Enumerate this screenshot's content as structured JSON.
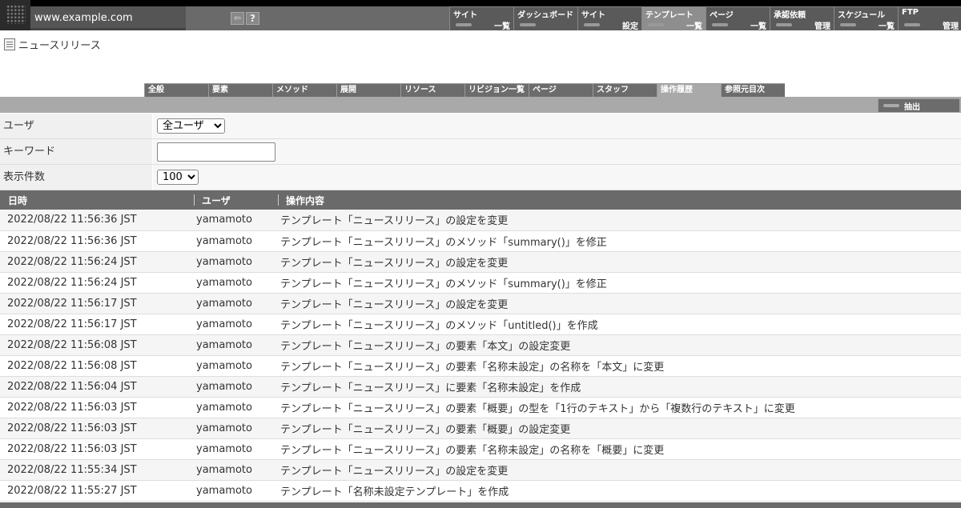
{
  "header": {
    "url": "www.example.com",
    "back_icon": "back-arrow-icon",
    "help_label": "?",
    "nav": [
      {
        "top": "サイト",
        "bottom": "一覧",
        "active": false
      },
      {
        "top": "ダッシュボード",
        "bottom": "",
        "active": false
      },
      {
        "top": "サイト",
        "bottom": "設定",
        "active": false
      },
      {
        "top": "テンプレート",
        "bottom": "一覧",
        "active": true
      },
      {
        "top": "ページ",
        "bottom": "一覧",
        "active": false
      },
      {
        "top": "承認依頼",
        "bottom": "管理",
        "active": false
      },
      {
        "top": "スケジュール",
        "bottom": "一覧",
        "active": false
      },
      {
        "top": "FTP",
        "bottom": "管理",
        "active": false
      }
    ]
  },
  "page": {
    "title": "ニュースリリース"
  },
  "tabs": [
    {
      "label": "全般",
      "active": false
    },
    {
      "label": "要素",
      "active": false
    },
    {
      "label": "メソッド",
      "active": false
    },
    {
      "label": "展開",
      "active": false
    },
    {
      "label": "リソース",
      "active": false
    },
    {
      "label": "リビジョン一覧",
      "active": false
    },
    {
      "label": "ページ",
      "active": false
    },
    {
      "label": "スタッフ",
      "active": false
    },
    {
      "label": "操作履歴",
      "active": true
    },
    {
      "label": "参照元目次",
      "active": false
    }
  ],
  "toolbar": {
    "extract_label": "抽出"
  },
  "filters": {
    "user_label": "ユーザ",
    "user_value": "全ユーザ",
    "keyword_label": "キーワード",
    "keyword_value": "",
    "count_label": "表示件数",
    "count_value": "100"
  },
  "table": {
    "headers": [
      "日時",
      "ユーザ",
      "操作内容"
    ],
    "rows": [
      [
        "2022/08/22 11:56:36 JST",
        "yamamoto",
        "テンプレート「ニュースリリース」の設定を変更"
      ],
      [
        "2022/08/22 11:56:36 JST",
        "yamamoto",
        "テンプレート「ニュースリリース」のメソッド「summary()」を修正"
      ],
      [
        "2022/08/22 11:56:24 JST",
        "yamamoto",
        "テンプレート「ニュースリリース」の設定を変更"
      ],
      [
        "2022/08/22 11:56:24 JST",
        "yamamoto",
        "テンプレート「ニュースリリース」のメソッド「summary()」を修正"
      ],
      [
        "2022/08/22 11:56:17 JST",
        "yamamoto",
        "テンプレート「ニュースリリース」の設定を変更"
      ],
      [
        "2022/08/22 11:56:17 JST",
        "yamamoto",
        "テンプレート「ニュースリリース」のメソッド「untitled()」を作成"
      ],
      [
        "2022/08/22 11:56:08 JST",
        "yamamoto",
        "テンプレート「ニュースリリース」の要素「本文」の設定変更"
      ],
      [
        "2022/08/22 11:56:08 JST",
        "yamamoto",
        "テンプレート「ニュースリリース」の要素「名称未設定」の名称を「本文」に変更"
      ],
      [
        "2022/08/22 11:56:04 JST",
        "yamamoto",
        "テンプレート「ニュースリリース」に要素「名称未設定」を作成"
      ],
      [
        "2022/08/22 11:56:03 JST",
        "yamamoto",
        "テンプレート「ニュースリリース」の要素「概要」の型を「1行のテキスト」から「複数行のテキスト」に変更"
      ],
      [
        "2022/08/22 11:56:03 JST",
        "yamamoto",
        "テンプレート「ニュースリリース」の要素「概要」の設定変更"
      ],
      [
        "2022/08/22 11:56:03 JST",
        "yamamoto",
        "テンプレート「ニュースリリース」の要素「名称未設定」の名称を「概要」に変更"
      ],
      [
        "2022/08/22 11:55:34 JST",
        "yamamoto",
        "テンプレート「ニュースリリース」の設定を変更"
      ],
      [
        "2022/08/22 11:55:27 JST",
        "yamamoto",
        "テンプレート「名称未設定テンプレート」を作成"
      ]
    ]
  }
}
